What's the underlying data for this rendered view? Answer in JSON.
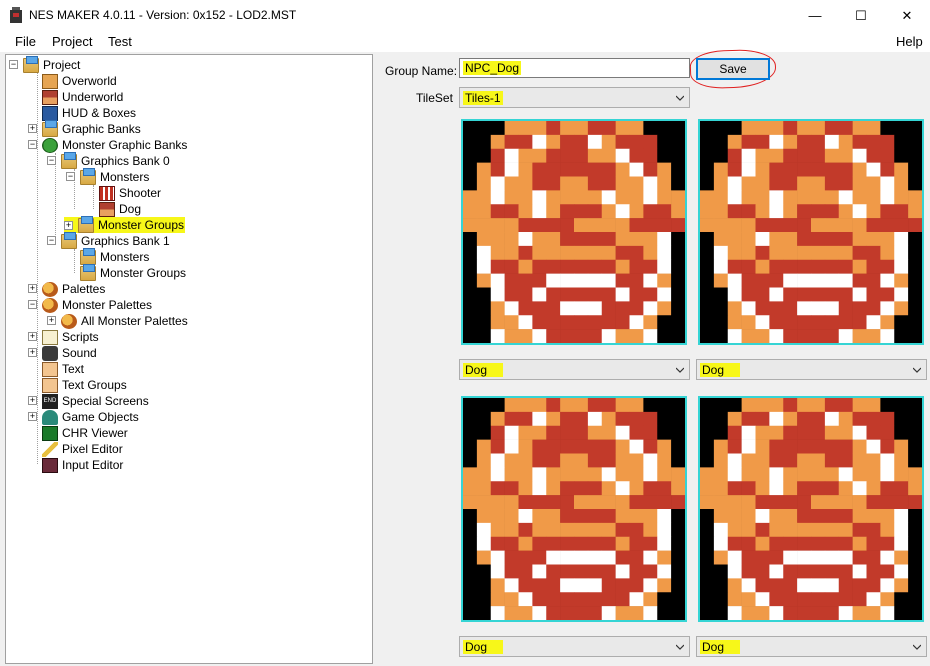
{
  "window": {
    "title": "NES MAKER 4.0.11 - Version: 0x152 - LOD2.MST",
    "minimize": "—",
    "maximize": "☐",
    "close": "✕"
  },
  "menu": {
    "file": "File",
    "project": "Project",
    "test": "Test",
    "help": "Help"
  },
  "tree": {
    "project": "Project",
    "overworld": "Overworld",
    "underworld": "Underworld",
    "hud": "HUD & Boxes",
    "graphic_banks": "Graphic Banks",
    "monster_graphic_banks": "Monster Graphic Banks",
    "graphics_bank_0": "Graphics Bank 0",
    "monsters_0": "Monsters",
    "shooter": "Shooter",
    "dog": "Dog",
    "monster_groups_0": "Monster Groups",
    "graphics_bank_1": "Graphics Bank 1",
    "monsters_1": "Monsters",
    "monster_groups_1": "Monster Groups",
    "palettes": "Palettes",
    "monster_palettes": "Monster Palettes",
    "all_monster_palettes": "All Monster Palettes",
    "scripts": "Scripts",
    "sound": "Sound",
    "text": "Text",
    "text_groups": "Text Groups",
    "special_screens": "Special Screens",
    "game_objects": "Game Objects",
    "chr_viewer": "CHR Viewer",
    "pixel_editor": "Pixel Editor",
    "input_editor": "Input Editor"
  },
  "form": {
    "group_name_label": "Group Name:",
    "group_name_value": "NPC_Dog",
    "save_label": "Save",
    "tileset_label": "TileSet",
    "tileset_value": "Tiles-1"
  },
  "slots": [
    {
      "monster": "Dog"
    },
    {
      "monster": "Dog"
    },
    {
      "monster": "Dog"
    },
    {
      "monster": "Dog"
    }
  ],
  "colors": {
    "highlight": "#f7f719",
    "sprite_border": "#35d4d4",
    "save_focus": "#0078d7",
    "annotation_red": "#e02020",
    "sprite_orange": "#f09a48",
    "sprite_red": "#c23a2a",
    "sprite_white": "#ffffff",
    "sprite_black": "#000000"
  }
}
